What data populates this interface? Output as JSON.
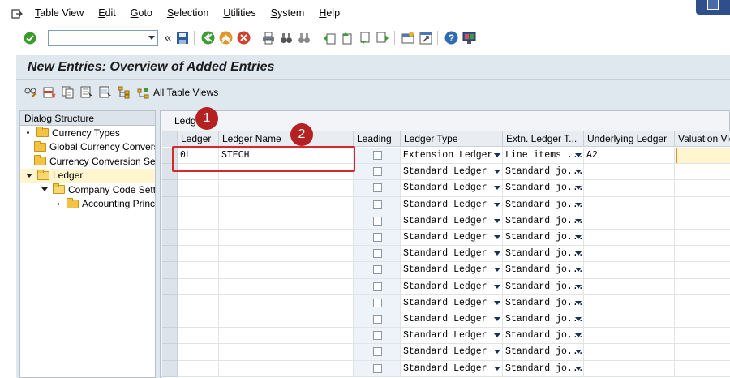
{
  "menu": {
    "items": [
      {
        "u": "T",
        "rest": "able View"
      },
      {
        "u": "E",
        "rest": "dit"
      },
      {
        "u": "G",
        "rest": "oto"
      },
      {
        "u": "S",
        "rest": "election"
      },
      {
        "u": "U",
        "rest": "tilities"
      },
      {
        "u": "S",
        "rest": "ystem"
      },
      {
        "u": "H",
        "rest": "elp"
      }
    ]
  },
  "toolbar": {
    "command_value": ""
  },
  "page": {
    "title": "New Entries: Overview of Added Entries"
  },
  "app_toolbar": {
    "all_table_views": "All Table Views"
  },
  "dialog_structure": {
    "title": "Dialog Structure",
    "items": [
      "Currency Types",
      "Global Currency Conversi",
      "Currency Conversion Set",
      "Ledger",
      "Company Code Setti",
      "Accounting Princ"
    ]
  },
  "table": {
    "tab_label": "Ledg",
    "columns": [
      "Ledger",
      "Ledger Name",
      "Leading",
      "Ledger Type",
      "Extn. Ledger T...",
      "Underlying Ledger",
      "Valuation Vie"
    ],
    "first_row": {
      "ledger": "0L",
      "name": "STECH",
      "type": "Extension Ledger",
      "extn": "Line items ...",
      "underlying": "A2"
    },
    "default_type": "Standard Ledger",
    "default_extn": "Standard jo..."
  },
  "annotations": {
    "badge1": "1",
    "badge2": "2",
    "color": "#b52020"
  }
}
